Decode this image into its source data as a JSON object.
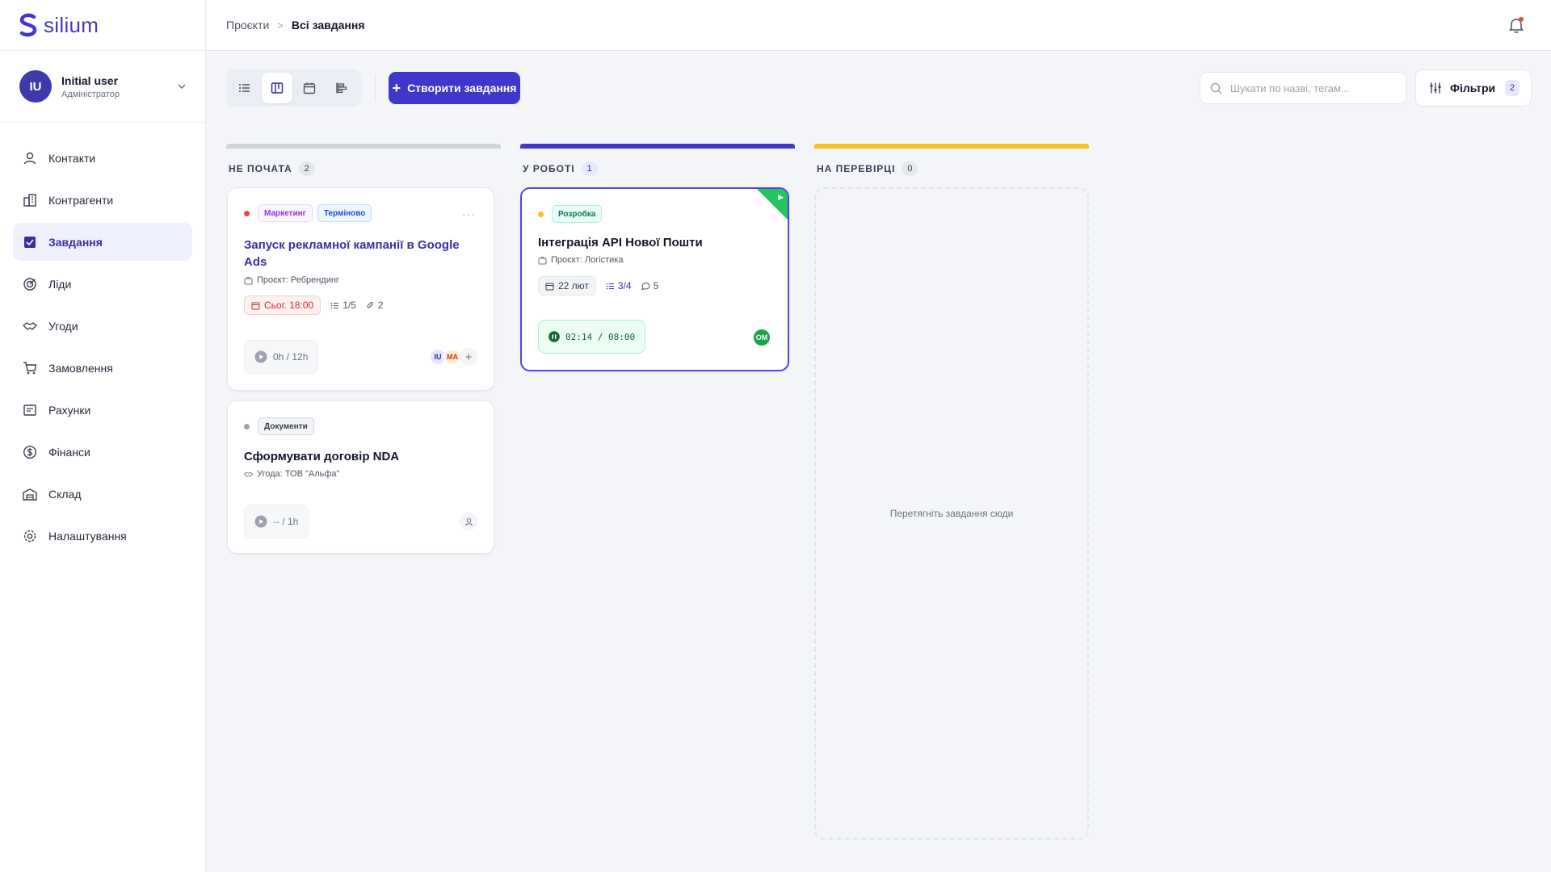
{
  "app": {
    "logo_text": "silium",
    "brand_color": "#4338ca"
  },
  "user": {
    "initials": "IU",
    "name": "Initial user",
    "role": "Адміністратор"
  },
  "nav": [
    {
      "label": "Контакти",
      "icon": "user-icon",
      "active": false
    },
    {
      "label": "Контрагенти",
      "icon": "building-icon",
      "active": false
    },
    {
      "label": "Завдання",
      "icon": "tasks-icon",
      "active": true
    },
    {
      "label": "Ліди",
      "icon": "target-icon",
      "active": false
    },
    {
      "label": "Угоди",
      "icon": "handshake-icon",
      "active": false
    },
    {
      "label": "Замовлення",
      "icon": "cart-icon",
      "active": false
    },
    {
      "label": "Рахунки",
      "icon": "invoice-icon",
      "active": false
    },
    {
      "label": "Фінанси",
      "icon": "dollar-icon",
      "active": false
    },
    {
      "label": "Склад",
      "icon": "warehouse-icon",
      "active": false
    },
    {
      "label": "Налаштування",
      "icon": "gear-icon",
      "active": false
    }
  ],
  "breadcrumb": {
    "parent": "Проєкти",
    "separator": ">",
    "current": "Всі завдання"
  },
  "toolbar": {
    "views": [
      "list",
      "kanban",
      "calendar",
      "gantt"
    ],
    "active_view": "kanban",
    "create_label": "Створити завдання",
    "search_placeholder": "Шукати по назві, тегам...",
    "search_value": "",
    "filters_label": "Фільтри",
    "filters_count": "2"
  },
  "columns": [
    {
      "title": "НЕ ПОЧАТА",
      "count": "2",
      "color": "#d1d5db"
    },
    {
      "title": "У РОБОТІ",
      "count": "1",
      "color": "#4338ca"
    },
    {
      "title": "НА ПЕРЕВІРЦІ",
      "count": "0",
      "color": "#fbbf24",
      "empty_text": "Перетягніть завдання сюди"
    }
  ],
  "cards": {
    "c1": {
      "priority_color": "#ef4444",
      "tags": [
        {
          "label": "Маркетинг"
        },
        {
          "label": "Терміново"
        }
      ],
      "more": "···",
      "title": "Запуск рекламної кампанії в Google Ads",
      "sub": "Проєкт: Ребрендинг",
      "due": "Сьог. 18:00",
      "subtasks": "1/5",
      "attachments": "2",
      "timer": "0h / 12h",
      "assignees": [
        "IU",
        "MA"
      ]
    },
    "c2": {
      "priority_color": "#9ca3af",
      "tags": [
        {
          "label": "Документи"
        }
      ],
      "title": "Сформувати договір NDA",
      "sub": "Угода: ТОВ \"Альфа\"",
      "timer": "-- / 1h"
    },
    "c3": {
      "priority_color": "#fbbf24",
      "tags": [
        {
          "label": "Розробка"
        }
      ],
      "title": "Інтеграція API Нової Пошти",
      "sub": "Проєкт: Логістика",
      "due": "22 лют",
      "subtasks": "3/4",
      "comments": "5",
      "timer": "02:14 / 08:00",
      "assignee": "OM"
    }
  }
}
